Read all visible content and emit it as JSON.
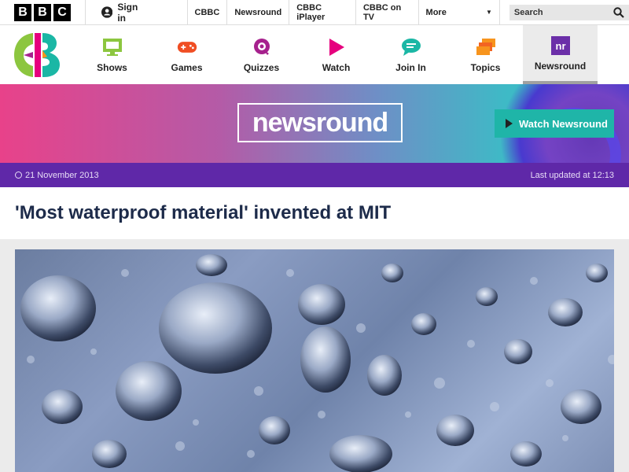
{
  "bbc_bar": {
    "logo_letters": [
      "B",
      "B",
      "C"
    ],
    "signin_label": "Sign in",
    "links": [
      "CBBC",
      "Newsround",
      "CBBC iPlayer",
      "CBBC on TV"
    ],
    "more_label": "More",
    "search_placeholder": "Search"
  },
  "cbbc_nav": {
    "items": [
      {
        "label": "Shows",
        "icon": "monitor-icon",
        "color": "#8cc63f"
      },
      {
        "label": "Games",
        "icon": "gamepad-icon",
        "color": "#f04e23"
      },
      {
        "label": "Quizzes",
        "icon": "quiz-icon",
        "color": "#a6218d"
      },
      {
        "label": "Watch",
        "icon": "play-icon",
        "color": "#e6007e"
      },
      {
        "label": "Join In",
        "icon": "speech-icon",
        "color": "#1bb7a5"
      },
      {
        "label": "Topics",
        "icon": "stack-icon",
        "color": "#f7941d"
      },
      {
        "label": "Newsround",
        "icon": "nr-icon",
        "color": "#6b2fa8"
      }
    ]
  },
  "banner": {
    "wordmark": "newsround",
    "watch_button": "Watch Newsround"
  },
  "article": {
    "date": "21 November 2013",
    "last_updated": "Last updated at 12:13",
    "headline": "'Most waterproof material' invented at MIT"
  },
  "colors": {
    "purple_bar": "#5f28a8",
    "headline": "#1d2b4a",
    "watch_button": "#1fb5a8"
  }
}
